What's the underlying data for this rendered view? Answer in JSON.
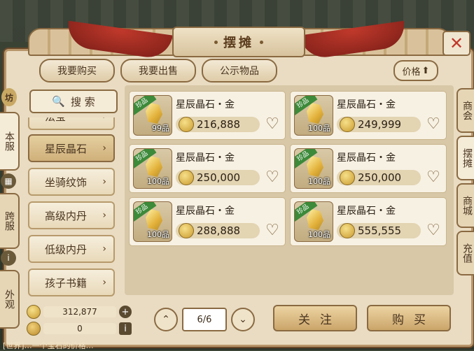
{
  "window": {
    "title": "摆摊"
  },
  "top_tabs": [
    {
      "label": "我要购买"
    },
    {
      "label": "我要出售"
    },
    {
      "label": "公示物品"
    }
  ],
  "sort": {
    "label": "价格"
  },
  "left_tabs": [
    {
      "label": "坊"
    },
    {
      "label": "本服"
    },
    {
      "label": "跨服"
    },
    {
      "label": "外观"
    }
  ],
  "right_tabs": [
    {
      "label": "商会"
    },
    {
      "label": "摆摊"
    },
    {
      "label": "商城"
    },
    {
      "label": "充值"
    }
  ],
  "search": {
    "label": "搜 索"
  },
  "categories": [
    {
      "label": "法宝"
    },
    {
      "label": "星辰晶石"
    },
    {
      "label": "坐骑纹饰"
    },
    {
      "label": "高级内丹"
    },
    {
      "label": "低级内丹"
    },
    {
      "label": "孩子书籍"
    }
  ],
  "currency": {
    "gold": "312,877",
    "bound": "0"
  },
  "listings": [
    {
      "name": "星辰晶石・金",
      "qty": "99品",
      "price": "216,888",
      "rare": "珍品"
    },
    {
      "name": "星辰晶石・金",
      "qty": "100品",
      "price": "249,999",
      "rare": "珍品"
    },
    {
      "name": "星辰晶石・金",
      "qty": "100品",
      "price": "250,000",
      "rare": "珍品"
    },
    {
      "name": "星辰晶石・金",
      "qty": "100品",
      "price": "250,000",
      "rare": "珍品"
    },
    {
      "name": "星辰晶石・金",
      "qty": "100品",
      "price": "288,888",
      "rare": "珍品"
    },
    {
      "name": "星辰晶石・金",
      "qty": "100品",
      "price": "555,555",
      "rare": "珍品"
    }
  ],
  "pager": {
    "page": "6/6"
  },
  "actions": {
    "follow": "关注",
    "buy": "购买"
  },
  "chat": {
    "text": "[世界]…一个宝石的价格…"
  },
  "colors": {
    "accent": "#8a6a42",
    "rare_badge": "#3c8a3a",
    "close": "#c0392b"
  }
}
